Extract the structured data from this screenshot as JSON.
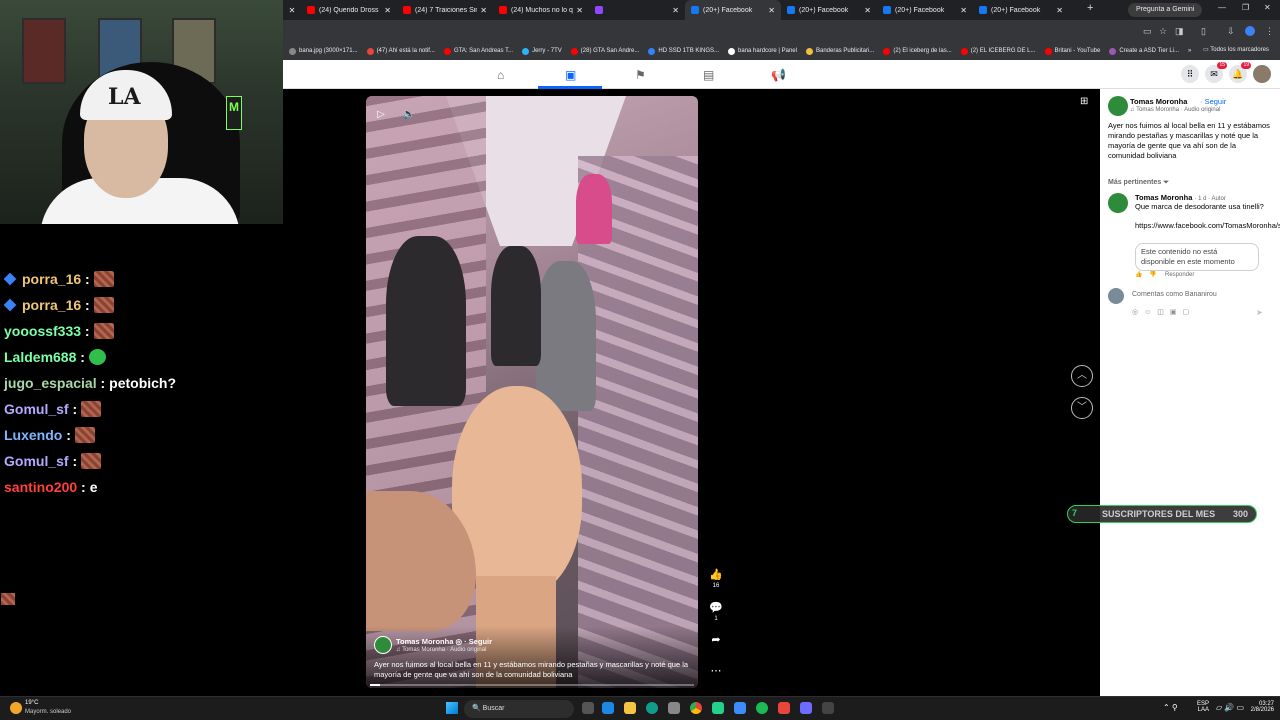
{
  "browser": {
    "tabs": [
      {
        "title": "(24) Querido Dross R",
        "active": false,
        "color": "#ff0000"
      },
      {
        "title": "(24) 7 Traiciones Sinie",
        "active": false,
        "color": "#ff0000"
      },
      {
        "title": "(24) Muchos no lo qui",
        "active": false,
        "color": "#ff0000"
      },
      {
        "title": "",
        "active": false,
        "color": "#9146ff"
      },
      {
        "title": "(20+) Facebook",
        "active": true,
        "color": "#1877f2"
      },
      {
        "title": "(20+) Facebook",
        "active": false,
        "color": "#1877f2"
      },
      {
        "title": "(20+) Facebook",
        "active": false,
        "color": "#1877f2"
      },
      {
        "title": "(20+) Facebook",
        "active": false,
        "color": "#1877f2"
      }
    ],
    "gemini_button": "Pregunta a Gemini",
    "bookmarks": [
      {
        "label": "bana.jpg (3000×171...",
        "color": "#888"
      },
      {
        "label": "(47) Ahí está la notif...",
        "color": "#e8453c"
      },
      {
        "label": "GTA: San Andreas T...",
        "color": "#ff0000"
      },
      {
        "label": "Jerry - 7TV",
        "color": "#29b6f6"
      },
      {
        "label": "(28) GTA San Andre...",
        "color": "#ff0000"
      },
      {
        "label": "HD SSD 1TB KINGS...",
        "color": "#3483fa"
      },
      {
        "label": "bana hardcore | Panel",
        "color": "#fff"
      },
      {
        "label": "Banderas Publicitari...",
        "color": "#f0c040"
      },
      {
        "label": "(2) El iceberg de las...",
        "color": "#ff0000"
      },
      {
        "label": "(2) EL ICEBERG DE L...",
        "color": "#ff0000"
      },
      {
        "label": "Britani - YouTube",
        "color": "#ff0000"
      },
      {
        "label": "Create a ASD Tier Li...",
        "color": "#9b59b6"
      }
    ],
    "all_bookmarks": "Todos los marcadores"
  },
  "facebook_nav": {
    "icons": [
      "home-icon",
      "video-icon",
      "flag-icon",
      "marketplace-icon",
      "megaphone-icon"
    ],
    "active_index": 1,
    "messenger_badge": "15",
    "notifications_badge": "19"
  },
  "chat": {
    "messages": [
      {
        "user": "porra_16",
        "color": "#f0c674",
        "badge": true,
        "text": "",
        "emote": "red"
      },
      {
        "user": "porra_16",
        "color": "#f0c674",
        "badge": true,
        "text": "",
        "emote": "red"
      },
      {
        "user": "yooossf333",
        "color": "#7cffa6",
        "badge": false,
        "text": "",
        "emote": "red"
      },
      {
        "user": "Laldem688",
        "color": "#7cffa6",
        "badge": false,
        "text": "",
        "emote": "green"
      },
      {
        "user": "jugo_espacial",
        "color": "#a8d8a8",
        "badge": false,
        "text": "petobich?",
        "emote": ""
      },
      {
        "user": "Gomul_sf",
        "color": "#b9a8ff",
        "badge": false,
        "text": "",
        "emote": "red"
      },
      {
        "user": "Luxendo",
        "color": "#7fb7ff",
        "badge": false,
        "text": "",
        "emote": "red"
      },
      {
        "user": "Gomul_sf",
        "color": "#b9a8ff",
        "badge": false,
        "text": "",
        "emote": "red"
      },
      {
        "user": "santino200",
        "color": "#ff4040",
        "badge": false,
        "text": "e",
        "emote": ""
      }
    ]
  },
  "video": {
    "author": "Tomas Moronha",
    "follow": "Seguir",
    "audio": "Tomas Moronha · Audio original",
    "caption": "Ayer nos fuimos al local bella en 11 y estábamos mirando pestañas y mascarillas y noté que la mayoría de gente que va ahí son de la comunidad boliviana",
    "progress": 0.03,
    "likes": "16",
    "comments": "1"
  },
  "subscriber_bar": {
    "count": "7",
    "label": "SUSCRIPTORES DEL MES",
    "goal": "300"
  },
  "panel": {
    "author": "Tomas Moronha",
    "follow": "· Seguir",
    "audio": "Tomas Moronha · Audio original",
    "caption": "Ayer nos fuimos al local bella en 11 y estábamos mirando pestañas y mascarillas y noté que la mayoría de gente que va ahí son de la comunidad boliviana",
    "relevant": "Más pertinentes",
    "comment": {
      "author": "Tomas Moronha",
      "meta": "· 1 d · Autor",
      "text": "Que marca de desodorante usa tinelli?",
      "link": "https://www.facebook.com/TomasMoronha/subscribenow...",
      "unavailable": "Este contenido no está disponible en este momento",
      "reply": "Responder"
    },
    "compose_placeholder": "Comentas como Bananirou"
  },
  "taskbar": {
    "temperature": "19°C",
    "weather": "Mayorm. soleado",
    "search": "Buscar",
    "lang": "ESP",
    "lang_sub": "LAA",
    "time": "03:27",
    "date": "2/8/2026"
  }
}
